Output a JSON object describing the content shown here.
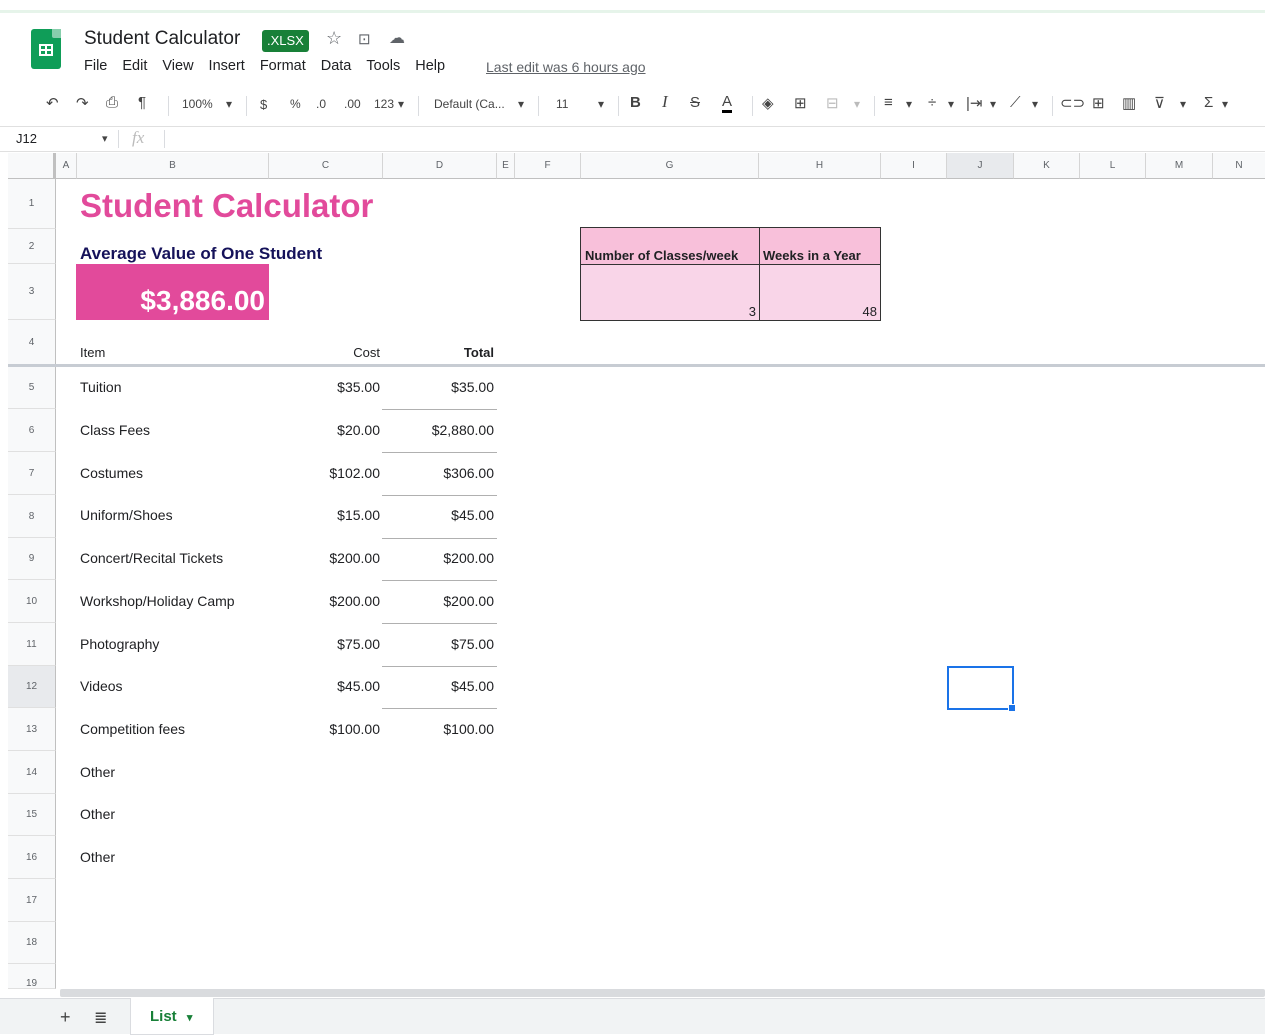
{
  "app": {
    "title": "Student Calculator",
    "badge": ".XLSX",
    "last_edit": "Last edit was 6 hours ago"
  },
  "menu": [
    "File",
    "Edit",
    "View",
    "Insert",
    "Format",
    "Data",
    "Tools",
    "Help"
  ],
  "toolbar": {
    "zoom": "100%",
    "currency": "$",
    "percent": "%",
    "dec_decrease": ".0",
    "dec_increase": ".00",
    "more_formats": "123",
    "font": "Default (Ca...",
    "font_size": "11",
    "bold": "B",
    "italic": "I"
  },
  "formula_bar": {
    "cell_ref": "J12",
    "fx": "fx"
  },
  "columns": [
    "A",
    "B",
    "C",
    "D",
    "E",
    "F",
    "G",
    "H",
    "I",
    "J",
    "K",
    "L",
    "M",
    "N"
  ],
  "rows": [
    "1",
    "2",
    "3",
    "4",
    "5",
    "6",
    "7",
    "8",
    "9",
    "10",
    "11",
    "12",
    "13",
    "14",
    "15",
    "16",
    "17",
    "18",
    "19"
  ],
  "sheet": {
    "title": "Student Calculator",
    "subtitle": "Average Value of One Student",
    "average_value": "$3,886.00",
    "table_headers": {
      "item": "Item",
      "cost": "Cost",
      "total": "Total"
    },
    "items": [
      {
        "item": "Tuition",
        "cost": "$35.00",
        "total": "$35.00"
      },
      {
        "item": "Class Fees",
        "cost": "$20.00",
        "total": "$2,880.00"
      },
      {
        "item": "Costumes",
        "cost": "$102.00",
        "total": "$306.00"
      },
      {
        "item": "Uniform/Shoes",
        "cost": "$15.00",
        "total": "$45.00"
      },
      {
        "item": "Concert/Recital Tickets",
        "cost": "$200.00",
        "total": "$200.00"
      },
      {
        "item": "Workshop/Holiday Camp",
        "cost": "$200.00",
        "total": "$200.00"
      },
      {
        "item": "Photography",
        "cost": "$75.00",
        "total": "$75.00"
      },
      {
        "item": "Videos",
        "cost": "$45.00",
        "total": "$45.00"
      },
      {
        "item": "Competition fees",
        "cost": "$100.00",
        "total": "$100.00"
      },
      {
        "item": "Other",
        "cost": "",
        "total": ""
      },
      {
        "item": "Other",
        "cost": "",
        "total": ""
      },
      {
        "item": "Other",
        "cost": "",
        "total": ""
      }
    ],
    "side_table": {
      "h1": "Number of Classes/week",
      "h2": "Weeks in a Year",
      "v1": "3",
      "v2": "48"
    }
  },
  "tabs": [
    {
      "label": "List"
    }
  ],
  "colors": {
    "accent": "#e24a9b",
    "title_navy": "#15125a",
    "pink_light": "#f9d5e8",
    "sheets_green": "#0f9d58",
    "selection": "#1a73e8"
  }
}
